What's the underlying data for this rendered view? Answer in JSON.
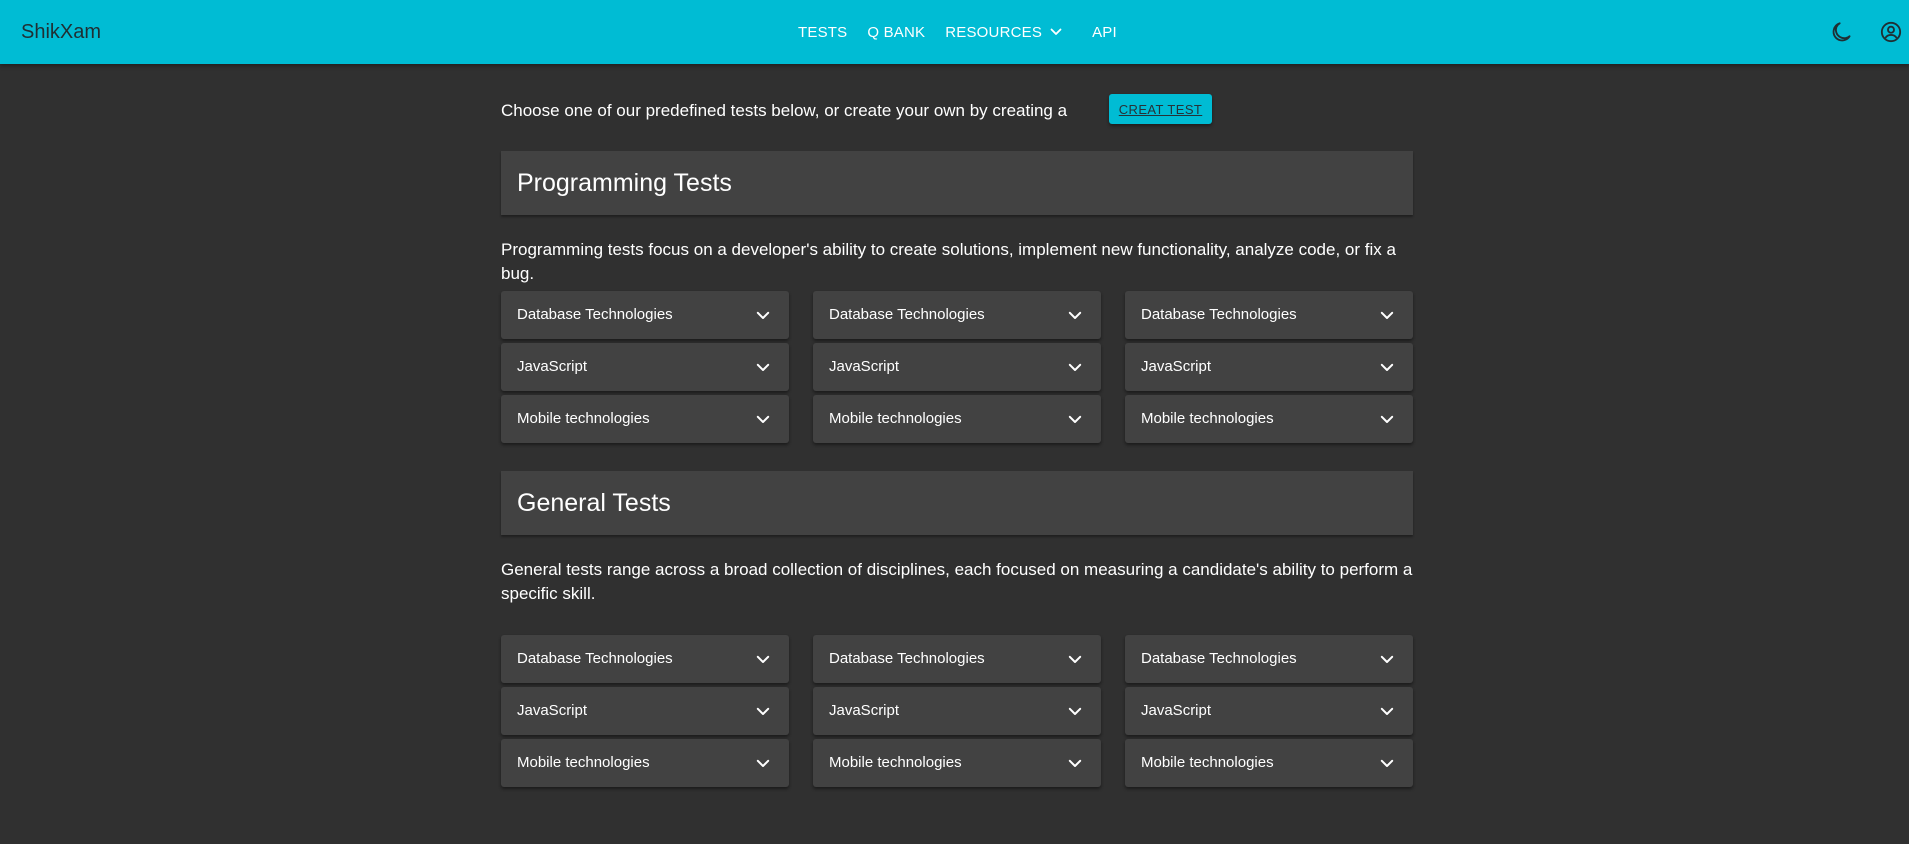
{
  "appbar": {
    "brand": "ShikXam",
    "nav": [
      {
        "label": "TESTS"
      },
      {
        "label": "Q BANK"
      },
      {
        "label": "RESOURCES"
      },
      {
        "label": "API"
      }
    ],
    "icons": {
      "theme": "moon-icon",
      "account": "account-circle-icon"
    },
    "color": "#00bcd4"
  },
  "intro": {
    "text": "Choose one of our predefined tests below, or create your own by creating a",
    "button_label": "CREAT TEST"
  },
  "sections": [
    {
      "title": "Programming Tests",
      "description": "Programming tests focus on a developer's ability to create solutions, implement new functionality, analyze code, or fix a bug.",
      "items": [
        "Database Technologies",
        "Database Technologies",
        "Database Technologies",
        "JavaScript",
        "JavaScript",
        "JavaScript",
        "Mobile technologies",
        "Mobile technologies",
        "Mobile technologies"
      ]
    },
    {
      "title": "General Tests",
      "description": "General tests range across a broad collection of disciplines, each focused on measuring a candidate's ability to perform a specific skill.",
      "items": [
        "Database Technologies",
        "Database Technologies",
        "Database Technologies",
        "JavaScript",
        "JavaScript",
        "JavaScript",
        "Mobile technologies",
        "Mobile technologies",
        "Mobile technologies"
      ]
    }
  ],
  "colors": {
    "accent": "#00bcd4",
    "background": "#303030",
    "surface": "#424242"
  }
}
